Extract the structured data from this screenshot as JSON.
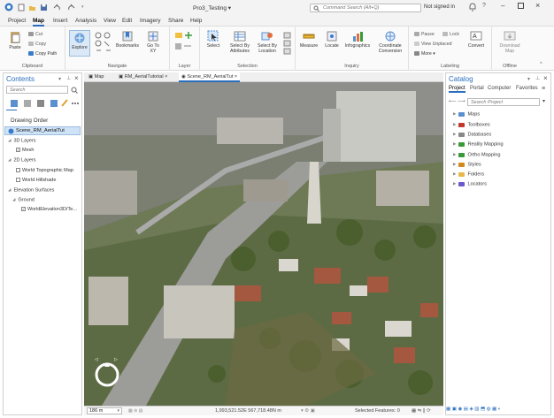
{
  "quick_access": {
    "icons": [
      "new-project-icon",
      "open-icon",
      "save-icon",
      "undo-icon",
      "redo-icon",
      "customize-icon"
    ]
  },
  "title": {
    "project_name": "Pro3_Testing",
    "search_placeholder": "Command Search (Alt+Q)",
    "signed_in": "Not signed in"
  },
  "tabs": [
    "Project",
    "Map",
    "Insert",
    "Analysis",
    "View",
    "Edit",
    "Imagery",
    "Share",
    "Help"
  ],
  "active_tab": "Map",
  "ribbon": {
    "clipboard": {
      "paste": "Paste",
      "cut": "Cut",
      "copy": "Copy",
      "copy_path": "Copy Path",
      "label": "Clipboard"
    },
    "navigate": {
      "explore": "Explore",
      "bookmarks": "Bookmarks",
      "goto": "Go To XY",
      "label": "Navigate"
    },
    "layer": {
      "label": "Layer"
    },
    "selection": {
      "select": "Select",
      "by_attributes": "Select By Attributes",
      "by_location": "Select By Location",
      "label": "Selection"
    },
    "inquiry": {
      "measure": "Measure",
      "locate": "Locate",
      "infographics": "Infographics",
      "coordinate": "Coordinate Conversion",
      "label": "Inquiry"
    },
    "labeling": {
      "pause": "Pause",
      "lock": "Lock",
      "view_unplaced": "View Unplaced",
      "more": "More",
      "convert": "Convert",
      "label": "Labeling"
    },
    "offline": {
      "download": "Download Map",
      "label": "Offline"
    }
  },
  "contents": {
    "title": "Contents",
    "search_placeholder": "Search",
    "drawing_order": "Drawing Order",
    "scene": "Scene_RM_AerialTut",
    "layers_3d": "3D Layers",
    "mesh": "Mesh",
    "layers_2d": "2D Layers",
    "topo": "World Topographic Map",
    "hillshade": "World Hillshade",
    "elevation": "Elevation Surfaces",
    "ground": "Ground",
    "world_elev": "WorldElevation3D/Te..."
  },
  "map_tabs": [
    "Map",
    "RM_AerialTutorial",
    "Scene_RM_AerialTut"
  ],
  "status": {
    "scale": "186 m",
    "coords": "1,993,521.52E 567,718.48N m",
    "selected": "Selected Features: 0"
  },
  "catalog": {
    "title": "Catalog",
    "tabs": [
      "Project",
      "Portal",
      "Computer",
      "Favorites"
    ],
    "search_placeholder": "Search Project",
    "items": [
      "Maps",
      "Toolboxes",
      "Databases",
      "Reality Mapping",
      "Ortho Mapping",
      "Styles",
      "Folders",
      "Locators"
    ]
  },
  "colors": {
    "accent": "#2a6ebd",
    "selected_row": "#cfe3f7"
  }
}
